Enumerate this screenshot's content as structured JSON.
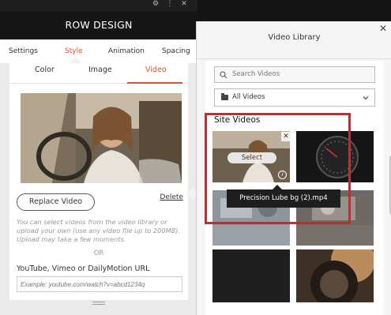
{
  "panel": {
    "title": "ROW DESIGN",
    "tabs": [
      {
        "label": "Settings"
      },
      {
        "label": "Style"
      },
      {
        "label": "Animation"
      },
      {
        "label": "Spacing"
      }
    ],
    "active_tab": "Style",
    "subtabs": [
      {
        "label": "Color"
      },
      {
        "label": "Image"
      },
      {
        "label": "Video"
      }
    ],
    "active_subtab": "Video",
    "replace_label": "Replace Video",
    "delete_label": "Delete",
    "helper_text": "You can select videos from the video library or upload your own (use any video file up to 200MB). Upload may take a few moments.",
    "or_text": "OR",
    "url_label": "YouTube, Vimeo or DailyMotion URL",
    "url_placeholder": "Example: youtube.com/watch?v=abcd1234q"
  },
  "library": {
    "title": "Video Library",
    "search_placeholder": "Search Videos",
    "filter_value": "All Videos",
    "section_label": "Site Videos",
    "select_label": "Select",
    "tooltip": "Precision Lube bg (2).mp4",
    "thumbs": [
      "woman-driving",
      "dashboard-gauge",
      "engine-closeup",
      "engine-parts",
      "dark",
      "tire-sunset"
    ]
  },
  "colors": {
    "accent": "#d9532c",
    "highlight": "#e01e26"
  }
}
